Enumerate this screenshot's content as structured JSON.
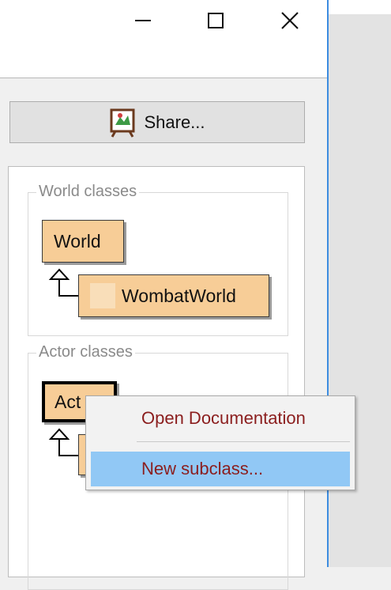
{
  "share": {
    "label": "Share..."
  },
  "world_classes": {
    "title": "World classes",
    "classes": [
      {
        "name": "World"
      },
      {
        "name": "WombatWorld"
      }
    ]
  },
  "actor_classes": {
    "title": "Actor classes",
    "classes": [
      {
        "name": "Actor",
        "visible_text": "Act"
      }
    ]
  },
  "context_menu": {
    "items": [
      {
        "label": "Open Documentation",
        "highlighted": false
      },
      {
        "label": "New subclass...",
        "highlighted": true
      }
    ]
  },
  "colors": {
    "class_fill": "#f7cd97",
    "menu_text": "#8b1e1e",
    "menu_highlight": "#91c8f5",
    "window_border": "#3c8ce0"
  }
}
